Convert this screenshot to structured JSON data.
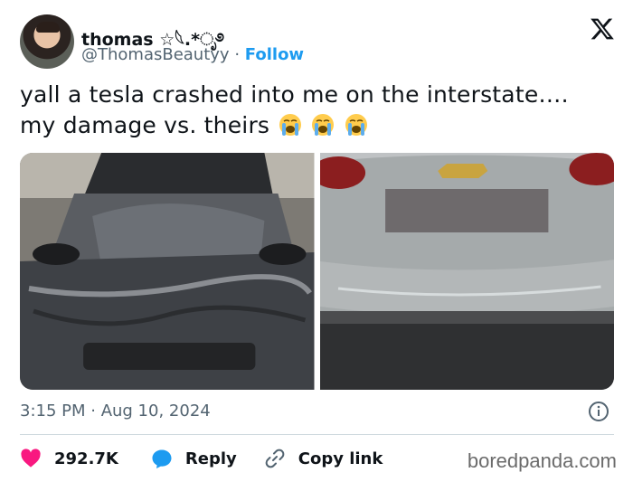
{
  "author": {
    "name": "thomas ☆𓆩.*ೃ࿔",
    "handle": "@ThomasBeautyy",
    "separator": "·",
    "follow_label": "Follow"
  },
  "tweet": {
    "text_line1": "yall a tesla crashed into me on the interstate….",
    "text_line2": "my damage vs. theirs",
    "emojis": [
      "loudly-crying-face",
      "loudly-crying-face",
      "loudly-crying-face"
    ],
    "timestamp": "3:15 PM · Aug 10, 2024"
  },
  "media": [
    {
      "name": "tesla-damage-photo"
    },
    {
      "name": "chevrolet-damage-photo"
    }
  ],
  "actions": {
    "likes": "292.7K",
    "reply_label": "Reply",
    "copy_label": "Copy link"
  },
  "watermark": "boredpanda.com",
  "colors": {
    "accent": "#1d9bf0",
    "heart": "#f91880",
    "muted": "#536471"
  }
}
